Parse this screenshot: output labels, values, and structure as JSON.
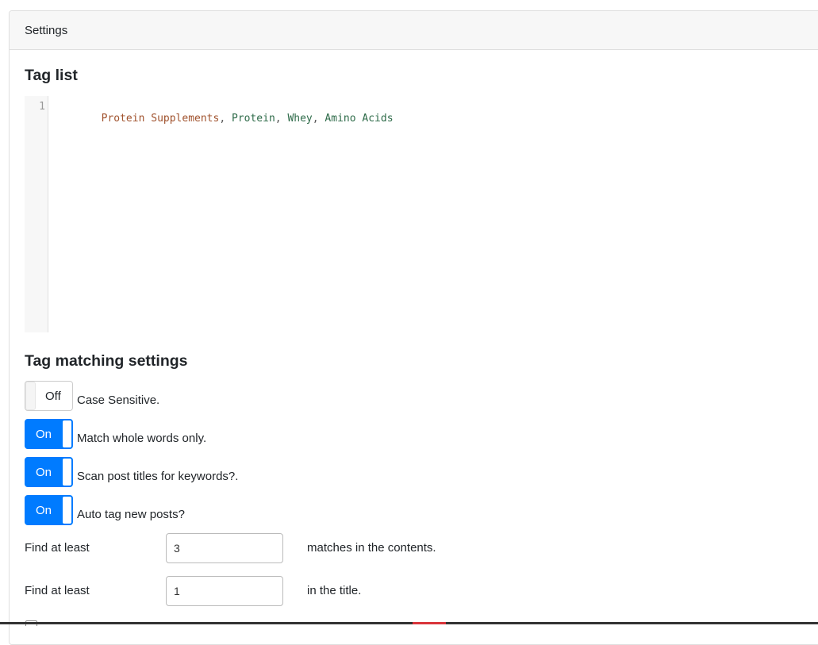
{
  "card": {
    "header_title": "Settings"
  },
  "tag_list": {
    "heading": "Tag list",
    "editor": {
      "line_number": "1",
      "tokens": [
        {
          "text": "Protein Supplements",
          "style": "a"
        },
        {
          "text": ", ",
          "style": "p"
        },
        {
          "text": "Protein",
          "style": "b"
        },
        {
          "text": ", ",
          "style": "p"
        },
        {
          "text": "Whey",
          "style": "b"
        },
        {
          "text": ", ",
          "style": "p"
        },
        {
          "text": "Amino Acids",
          "style": "b"
        }
      ]
    }
  },
  "matching": {
    "heading": "Tag matching settings",
    "toggles": [
      {
        "state": "Off",
        "label": "Case Sensitive.",
        "on": false
      },
      {
        "state": "On",
        "label": "Match whole words only.",
        "on": true
      },
      {
        "state": "On",
        "label": "Scan post titles for keywords?.",
        "on": true
      },
      {
        "state": "On",
        "label": "Auto tag new posts?",
        "on": true
      }
    ],
    "find_rows": [
      {
        "label": "Find at least",
        "value": "3",
        "suffix": "matches in the contents."
      },
      {
        "label": "Find at least",
        "value": "1",
        "suffix": "in the title."
      }
    ]
  },
  "colors": {
    "accent": "#007bff",
    "header_bg": "#f7f7f7",
    "border": "#dfdfdf"
  }
}
